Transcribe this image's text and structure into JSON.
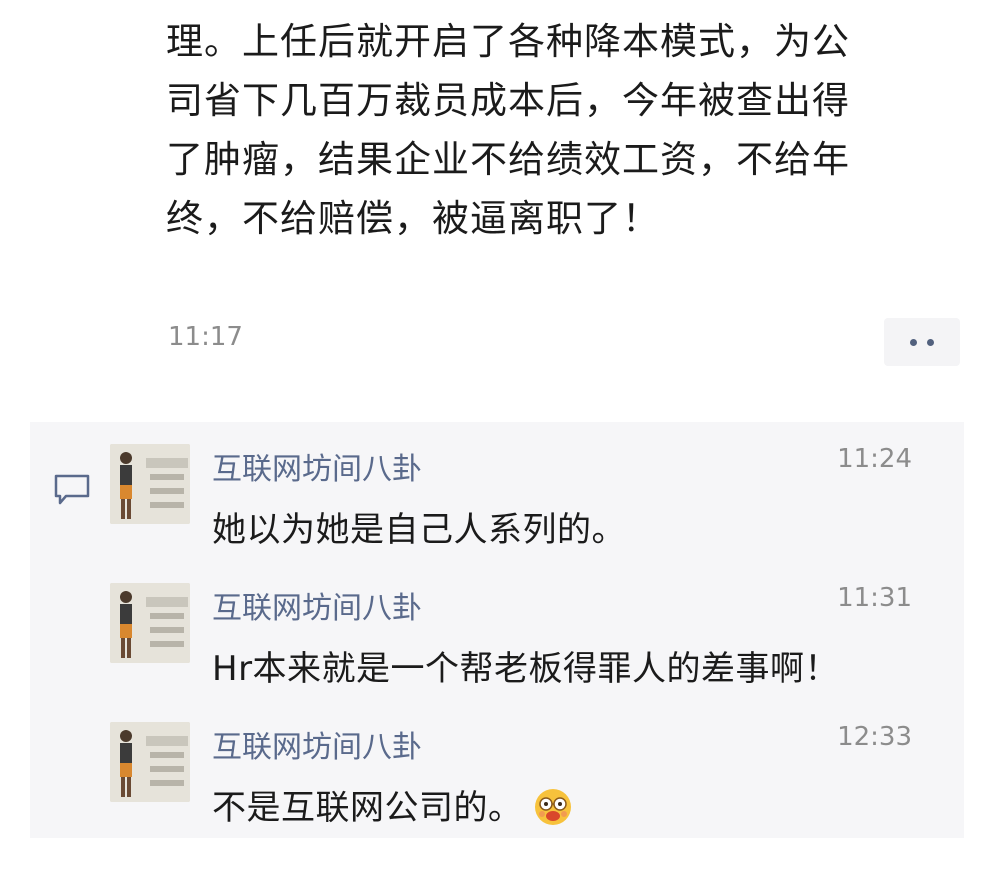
{
  "post": {
    "lines": [
      "理。上任后就开启了各种降本模式，为公",
      "司省下几百万裁员成本后，今年被查出得",
      "了肿瘤，结果企业不给绩效工资，不给年",
      "终，不给赔偿，被逼离职了！"
    ],
    "time": "11:17",
    "more_icon": "more-dots-icon"
  },
  "comments": [
    {
      "author": "互联网坊间八卦",
      "time": "11:24",
      "text": "她以为她是自己人系列的。"
    },
    {
      "author": "互联网坊间八卦",
      "time": "11:31",
      "text": "Hr本来就是一个帮老板得罪人的差事啊！"
    },
    {
      "author": "互联网坊间八卦",
      "time": "12:33",
      "text": "不是互联网公司的。",
      "emoji": "smiling-face-with-glasses-emoji"
    }
  ],
  "colors": {
    "name_link": "#5a6a8c",
    "panel_bg": "#f6f6f8",
    "time_gray": "#8c8c8c",
    "text": "#1b1b1b"
  }
}
